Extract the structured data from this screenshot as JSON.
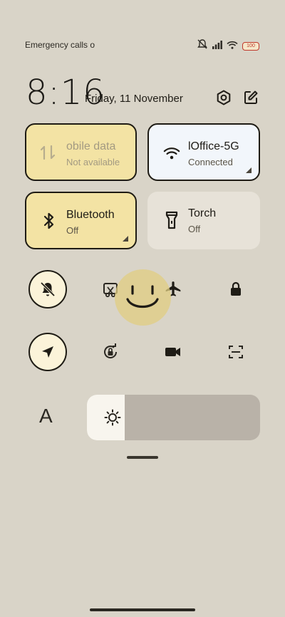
{
  "status_bar": {
    "carrier_text": "Emergency calls o",
    "battery": "100"
  },
  "header": {
    "time": "8:16",
    "date": "Friday, 11 November"
  },
  "tiles": {
    "mobile_data": {
      "label": "obile data",
      "status": "Not available"
    },
    "wifi": {
      "label": "lOffice-5G",
      "status": "Connected"
    },
    "bluetooth": {
      "label": "Bluetooth",
      "status": "Off"
    },
    "torch": {
      "label": "Torch",
      "status": "Off"
    }
  },
  "toggles": {
    "silent": {
      "state": "on"
    },
    "screenshot": {
      "state": "off"
    },
    "airplane": {
      "state": "off"
    },
    "lock": {
      "state": "off"
    },
    "location": {
      "state": "on"
    },
    "rotation_lock": {
      "state": "off"
    },
    "screen_record": {
      "state": "off"
    },
    "scanner": {
      "state": "off"
    }
  },
  "font_size_glyph": "A",
  "brightness": {
    "level": 0.22
  },
  "colors": {
    "background": "#d9d4c8",
    "tile_active": "#f3e3a4",
    "tile_wifi": "#f2f6fb",
    "tile_inactive": "#e7e2d8",
    "outline": "#1e1b14",
    "overlay": "#e0cd82"
  }
}
